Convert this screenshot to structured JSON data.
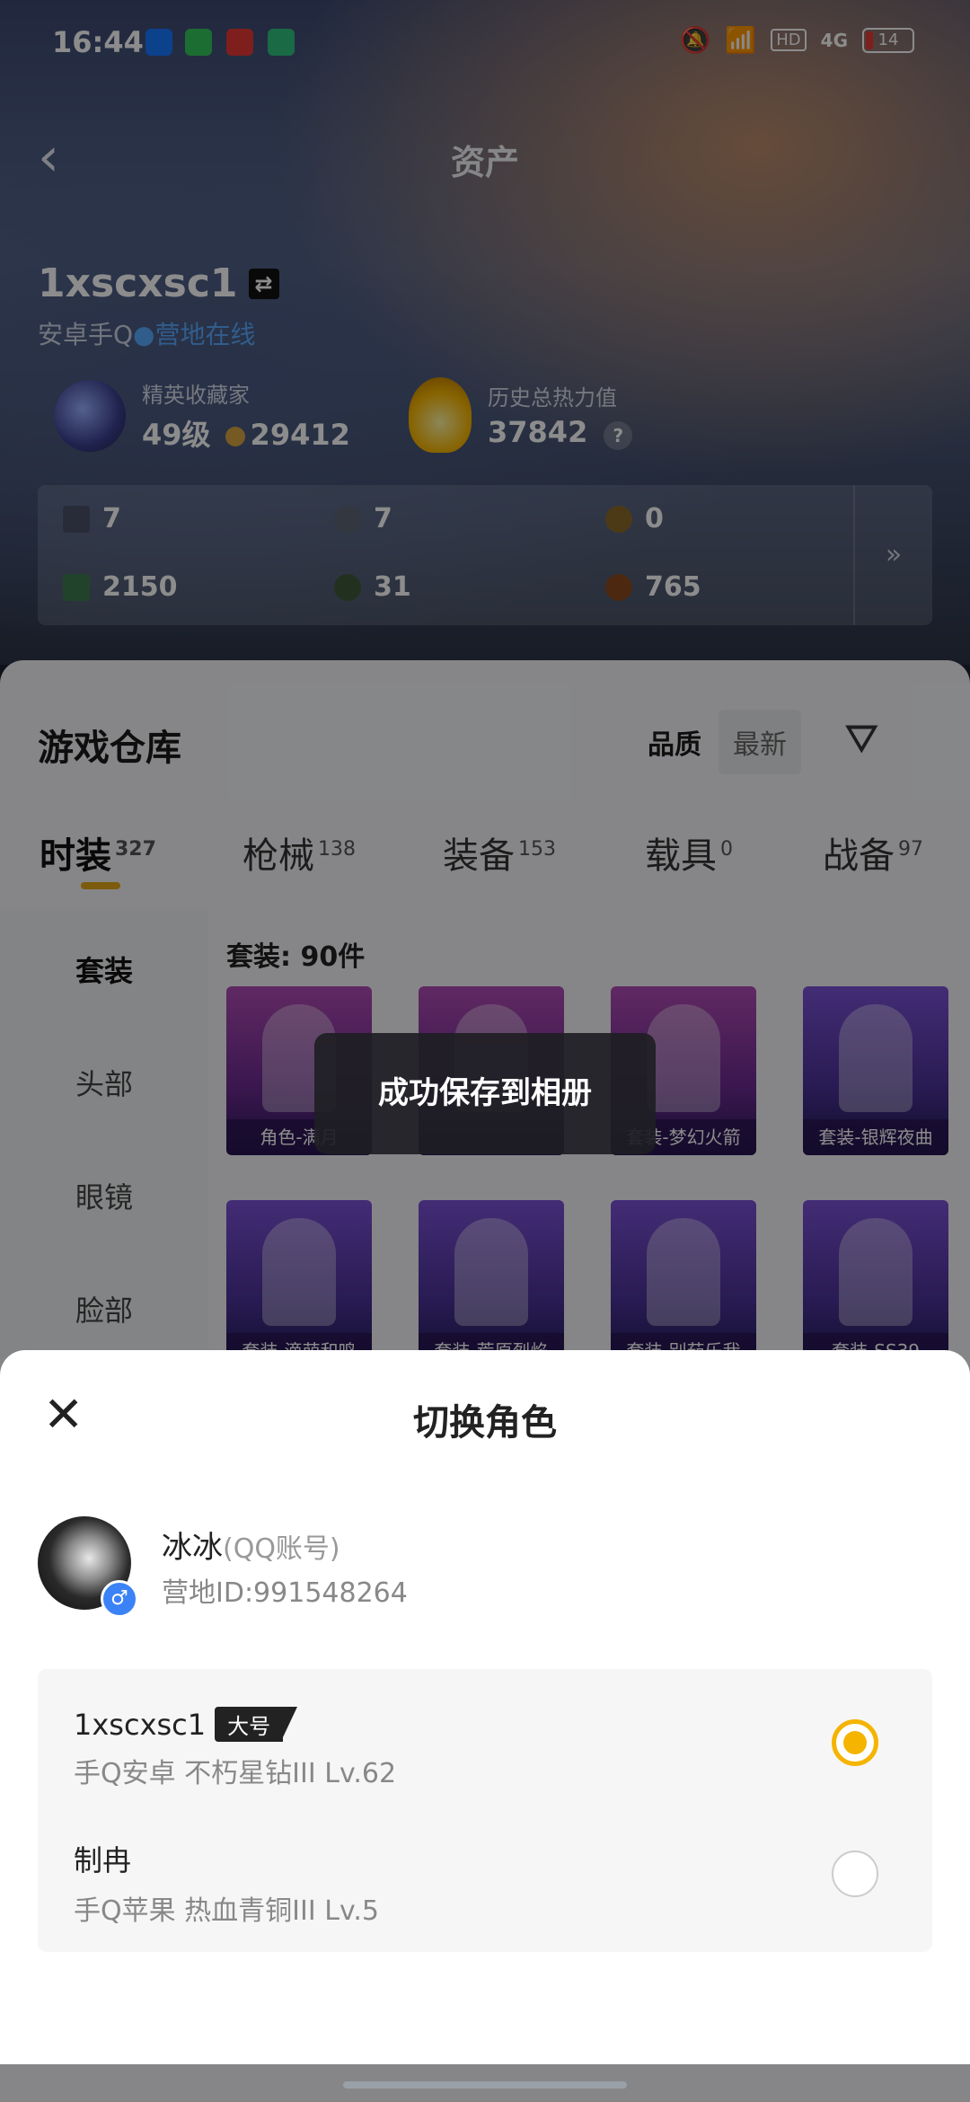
{
  "status_bar": {
    "time": "16:44",
    "battery": "14",
    "network": "4G",
    "hd": "HD"
  },
  "header": {
    "back_icon": "chevron-left-icon",
    "title": "资产"
  },
  "profile": {
    "name": "1xscxsc1",
    "platform": "安卓手Q",
    "online_status": "营地在线"
  },
  "stats": {
    "collector_label": "精英收藏家",
    "collector_level": "49级",
    "collector_points": "29412",
    "heat_label": "历史总热力值",
    "heat_value": "37842",
    "help": "?"
  },
  "resources": {
    "row1": [
      "7",
      "7",
      "0"
    ],
    "row2": [
      "2150",
      "31",
      "765"
    ],
    "more": "»"
  },
  "warehouse": {
    "title": "游戏仓库",
    "sort_quality": "品质",
    "sort_latest": "最新",
    "tabs": [
      {
        "label": "时装",
        "count": "327"
      },
      {
        "label": "枪械",
        "count": "138"
      },
      {
        "label": "装备",
        "count": "153"
      },
      {
        "label": "载具",
        "count": "0"
      },
      {
        "label": "战备",
        "count": "97"
      }
    ],
    "side": [
      "套装",
      "头部",
      "眼镜",
      "脸部"
    ],
    "count_line": "套装: 90件",
    "cards": [
      "角色-满月",
      "",
      "套装-梦幻火箭",
      "套装-银辉夜曲",
      "套装-滴萌和鸣",
      "套装-荒原烈焰",
      "套装-别茄乐我",
      "套装-SS39"
    ]
  },
  "toast": "成功保存到相册",
  "sheet": {
    "title": "切换角色",
    "user_name": "冰冰",
    "account_type": "(QQ账号)",
    "camp_id": "营地ID:991548264",
    "roles": [
      {
        "name": "1xscxsc1",
        "tag": "大号",
        "info": "手Q安卓  不朽星钻III  Lv.62",
        "selected": true
      },
      {
        "name": "制冉",
        "tag": "",
        "info": "手Q苹果  热血青铜III  Lv.5",
        "selected": false
      }
    ]
  },
  "colors": {
    "accent": "#f5b400",
    "online": "#5aa9ff"
  }
}
